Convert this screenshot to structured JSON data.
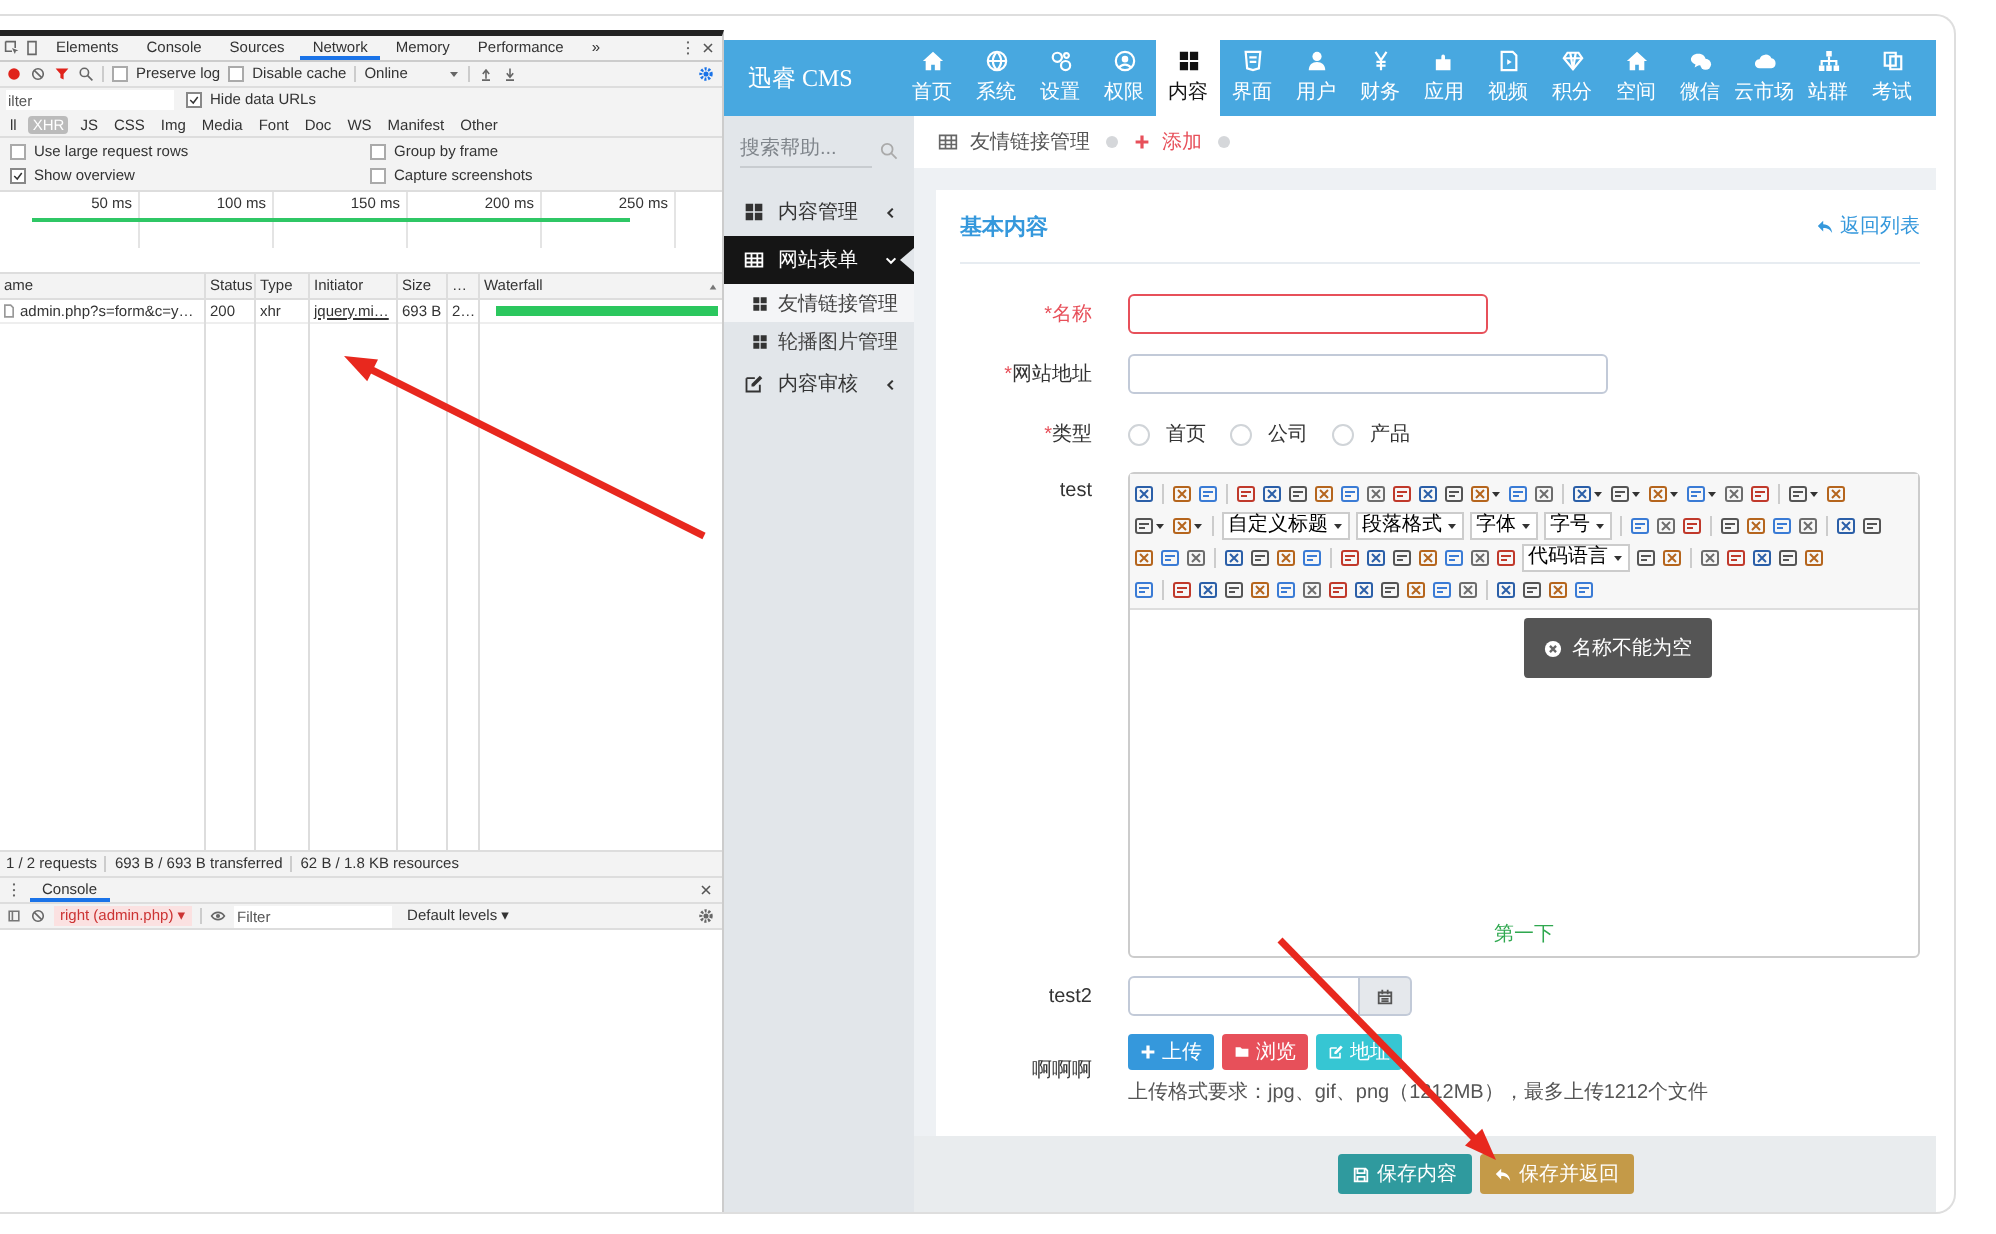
{
  "devtools": {
    "tabs": [
      {
        "label": "Elements",
        "selected": false
      },
      {
        "label": "Console",
        "selected": false
      },
      {
        "label": "Sources",
        "selected": false
      },
      {
        "label": "Network",
        "selected": true
      },
      {
        "label": "Memory",
        "selected": false
      },
      {
        "label": "Performance",
        "selected": false
      }
    ],
    "more": "»",
    "preserve_log": {
      "label": "Preserve log",
      "checked": false
    },
    "disable_cache": {
      "label": "Disable cache",
      "checked": false
    },
    "throttling": "Online",
    "filter": {
      "placeholder": "ilter"
    },
    "hide_data_urls": {
      "label": "Hide data URLs",
      "checked": true
    },
    "type_filters": [
      {
        "label": "ll",
        "selected": false
      },
      {
        "label": "XHR",
        "selected": true
      },
      {
        "label": "JS",
        "selected": false
      },
      {
        "label": "CSS",
        "selected": false
      },
      {
        "label": "Img",
        "selected": false
      },
      {
        "label": "Media",
        "selected": false
      },
      {
        "label": "Font",
        "selected": false
      },
      {
        "label": "Doc",
        "selected": false
      },
      {
        "label": "WS",
        "selected": false
      },
      {
        "label": "Manifest",
        "selected": false
      },
      {
        "label": "Other",
        "selected": false
      }
    ],
    "options": [
      {
        "label": "Use large request rows",
        "checked": false
      },
      {
        "label": "Group by frame",
        "checked": false
      },
      {
        "label": "Show overview",
        "checked": true
      },
      {
        "label": "Capture screenshots",
        "checked": false
      }
    ],
    "overview_ticks": [
      "50 ms",
      "100 ms",
      "150 ms",
      "200 ms",
      "250 ms"
    ],
    "columns": [
      "ame",
      "Status",
      "Type",
      "Initiator",
      "Size",
      "…",
      "Waterfall"
    ],
    "rows": [
      {
        "cells": [
          "admin.php?s=form&c=y…",
          "200",
          "xhr",
          "jquery.mi…",
          "693 B",
          "2…"
        ]
      }
    ],
    "summary": [
      "1 / 2 requests",
      "693 B / 693 B transferred",
      "62 B / 1.8 KB resources"
    ],
    "drawer_tab": "Console",
    "console_context": "right (admin.php) ▾",
    "console_filter": {
      "placeholder": "Filter"
    },
    "log_levels": "Default levels ▾"
  },
  "cms": {
    "logo": "迅睿 CMS",
    "nav": [
      {
        "label": "首页",
        "selected": false
      },
      {
        "label": "系统",
        "selected": false
      },
      {
        "label": "设置",
        "selected": false
      },
      {
        "label": "权限",
        "selected": false
      },
      {
        "label": "内容",
        "selected": true
      },
      {
        "label": "界面",
        "selected": false
      },
      {
        "label": "用户",
        "selected": false
      },
      {
        "label": "财务",
        "selected": false
      },
      {
        "label": "应用",
        "selected": false
      },
      {
        "label": "视频",
        "selected": false
      },
      {
        "label": "积分",
        "selected": false
      },
      {
        "label": "空间",
        "selected": false
      },
      {
        "label": "微信",
        "selected": false
      },
      {
        "label": "云市场",
        "selected": false
      },
      {
        "label": "站群",
        "selected": false
      },
      {
        "label": "考试",
        "selected": false
      }
    ],
    "search": {
      "placeholder": "搜索帮助..."
    },
    "sidebar": [
      {
        "label": "内容管理",
        "expanded": false,
        "selected": false
      },
      {
        "label": "网站表单",
        "expanded": true,
        "selected": true,
        "children": [
          {
            "label": "友情链接管理",
            "selected": true
          },
          {
            "label": "轮播图片管理",
            "selected": false
          }
        ]
      },
      {
        "label": "内容审核",
        "expanded": false,
        "selected": false
      }
    ],
    "breadcrumb": [
      {
        "label": "友情链接管理",
        "selected": false
      },
      {
        "label": "添加",
        "selected": true
      }
    ],
    "card": {
      "title": "基本内容",
      "back_link": "返回列表"
    },
    "fields": [
      {
        "kind": "text",
        "label": "名称",
        "mark": "*",
        "error": true
      },
      {
        "kind": "url",
        "label": "网站地址",
        "mark": "*",
        "error": false
      },
      {
        "kind": "radio",
        "label": "类型",
        "mark": "*",
        "error": false,
        "options": [
          {
            "label": "首页",
            "selected": false
          },
          {
            "label": "公司",
            "selected": false
          },
          {
            "label": "产品",
            "selected": false
          }
        ]
      },
      {
        "kind": "editor",
        "label": "test",
        "error": false,
        "selects": [
          "自定义标题",
          "段落格式",
          "字体",
          "字号",
          "代码语言"
        ],
        "content": "第一下",
        "toast": "名称不能为空"
      },
      {
        "kind": "date",
        "label": "test2",
        "error": false
      },
      {
        "kind": "upload",
        "label": "啊啊啊",
        "error": false,
        "buttons": [
          {
            "label": "上传",
            "color": "#3598dc"
          },
          {
            "label": "浏览",
            "color": "#e7505a"
          },
          {
            "label": "地址",
            "color": "#36c6d3"
          }
        ],
        "hint": "上传格式要求：jpg、gif、png（1212MB），最多上传1212个文件"
      }
    ],
    "actions": [
      {
        "label": "保存内容",
        "color": "#2f9a9e"
      },
      {
        "label": "保存并返回",
        "color": "#c49a48"
      }
    ]
  }
}
